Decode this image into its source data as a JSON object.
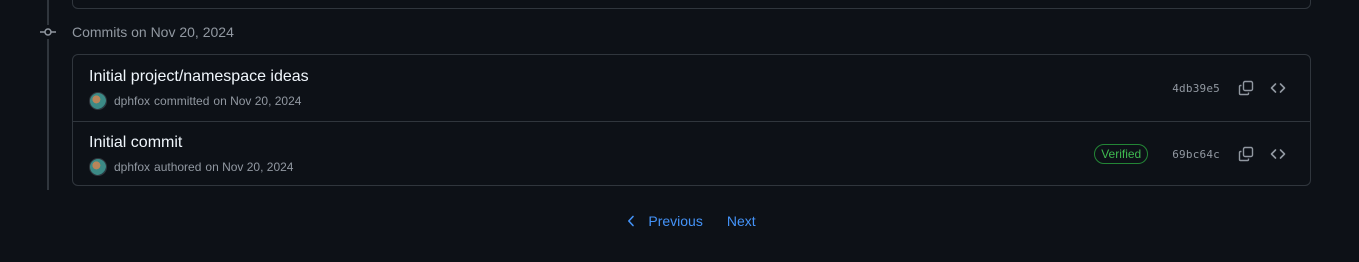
{
  "group": {
    "heading": "Commits on Nov 20, 2024"
  },
  "commits": [
    {
      "title": "Initial project/namespace ideas",
      "author": "dphfox",
      "action": "committed",
      "date": "on Nov 20, 2024",
      "verified": false,
      "sha": "4db39e5"
    },
    {
      "title": "Initial commit",
      "author": "dphfox",
      "action": "authored",
      "date": "on Nov 20, 2024",
      "verified": true,
      "verified_label": "Verified",
      "sha": "69bc64c"
    }
  ],
  "pagination": {
    "previous_label": "Previous",
    "next_label": "Next"
  },
  "colors": {
    "background": "#0d1117",
    "border": "#30363d",
    "link": "#4493f8",
    "verified": "#3fb950",
    "muted": "#9198a1"
  },
  "icons": {
    "timeline": "git-commit-icon",
    "copy": "copy-icon",
    "browse": "code-icon",
    "prev": "chevron-left-icon"
  }
}
